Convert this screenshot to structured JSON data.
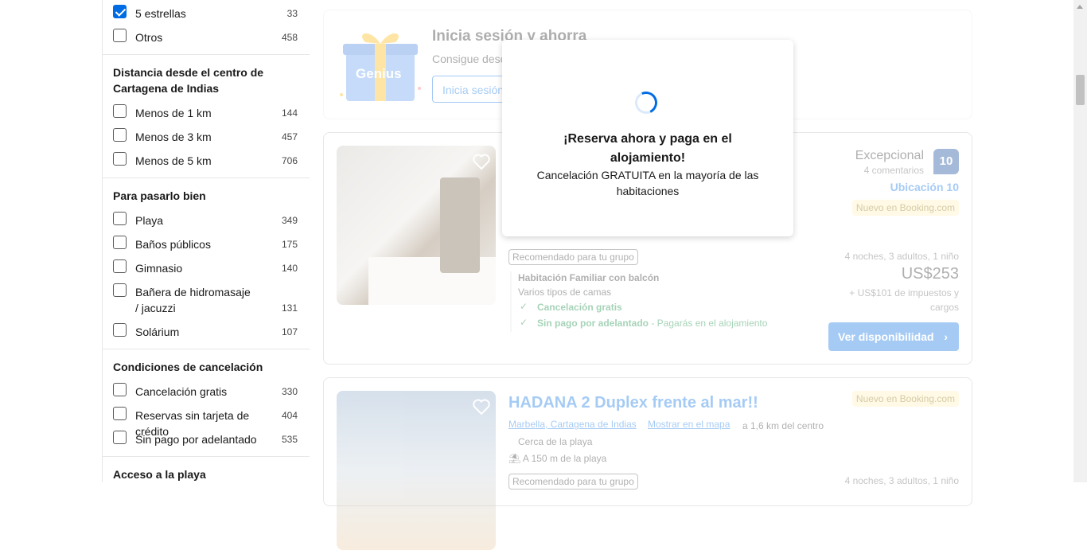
{
  "sidebar": {
    "stars": [
      {
        "label": "5 estrellas",
        "count": "33",
        "checked": true
      },
      {
        "label": "Otros",
        "count": "458",
        "checked": false
      }
    ],
    "distance": {
      "title": "Distancia desde el centro de Cartagena de Indias",
      "items": [
        {
          "label": "Menos de 1 km",
          "count": "144"
        },
        {
          "label": "Menos de 3 km",
          "count": "457"
        },
        {
          "label": "Menos de 5 km",
          "count": "706"
        }
      ]
    },
    "fun": {
      "title": "Para pasarlo bien",
      "items": [
        {
          "label": "Playa",
          "count": "349"
        },
        {
          "label": "Baños públicos",
          "count": "175"
        },
        {
          "label": "Gimnasio",
          "count": "140"
        },
        {
          "label": "Bañera de hidromasaje / jacuzzi",
          "count": "131"
        },
        {
          "label": "Solárium",
          "count": "107"
        }
      ]
    },
    "cancel": {
      "title": "Condiciones de cancelación",
      "items": [
        {
          "label": "Cancelación gratis",
          "count": "330"
        },
        {
          "label": "Reservas sin tarjeta de crédito",
          "count": "404"
        },
        {
          "label": "Sin pago por adelantado",
          "count": "535"
        }
      ]
    },
    "beach_title": "Acceso a la playa"
  },
  "genius": {
    "logo": "Genius",
    "title": "Inicia sesión y ahorra",
    "subtitle": "Consigue desc",
    "button": "Inicia sesión"
  },
  "listing1": {
    "rating_word": "Excepcional",
    "reviews": "4 comentarios",
    "score": "10",
    "location_score": "Ubicación 10",
    "new_badge": "Nuevo en Booking.com",
    "recommended": "Recomendado para tu grupo",
    "room": "Habitación Familiar con balcón",
    "beds": "Varios tipos de camas",
    "free_cancel": "Cancelación gratis",
    "no_prepay": "Sin pago por adelantado",
    "no_prepay_note": " - Pagarás en el alojamiento",
    "stay": "4 noches, 3 adultos, 1 niño",
    "price": "US$253",
    "taxes": "+ US$101 de impuestos y cargos",
    "cta": "Ver disponibilidad"
  },
  "listing2": {
    "title": "HADANA 2 Duplex frente al mar!!",
    "location": "Marbella, Cartagena de Indias",
    "map_link": "Mostrar en el mapa",
    "distance": "a 1,6 km del centro",
    "near": "Cerca de la playa",
    "beach": "A 150 m de la playa",
    "new_badge": "Nuevo en Booking.com",
    "recommended": "Recomendado para tu grupo",
    "stay": "4 noches, 3 adultos, 1 niño"
  },
  "modal": {
    "title": "¡Reserva ahora y paga en el alojamiento!",
    "subtitle": "Cancelación GRATUITA en la mayoría de las habitaciones"
  },
  "colors": {
    "primary": "#006ce4",
    "dark_blue": "#003b95",
    "green": "#008234",
    "new_badge_bg": "#ffeeba"
  }
}
